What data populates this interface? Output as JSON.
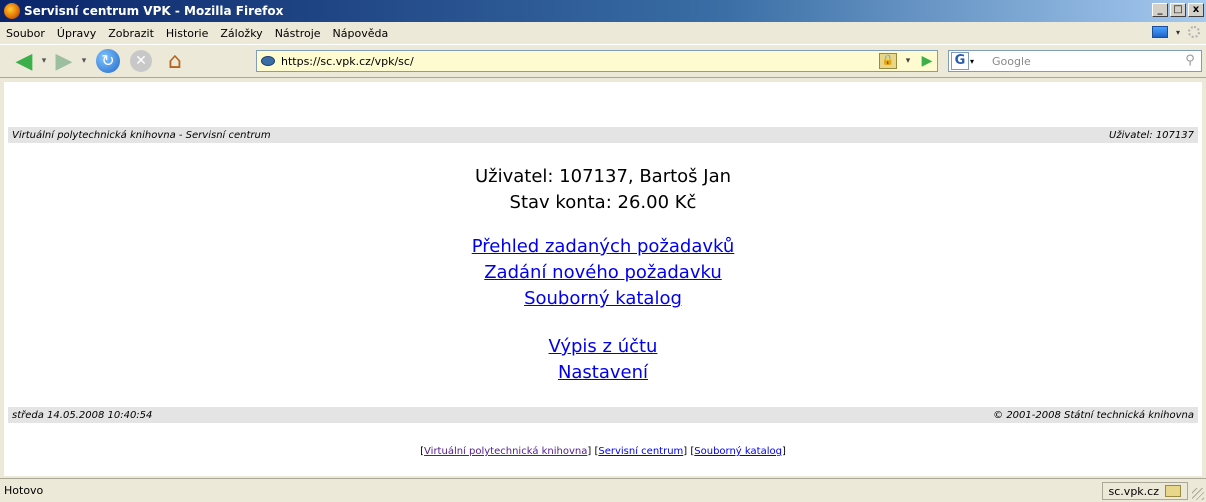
{
  "window": {
    "title": "Servisní centrum VPK - Mozilla Firefox",
    "controls": [
      "_",
      "□",
      "x"
    ]
  },
  "menu": {
    "items": [
      "Soubor",
      "Úpravy",
      "Zobrazit",
      "Historie",
      "Záložky",
      "Nástroje",
      "Nápověda"
    ]
  },
  "nav": {
    "url": "https://sc.vpk.cz/vpk/sc/",
    "search_placeholder": "Google",
    "search_engine_letter": "G"
  },
  "page": {
    "header_left": "Virtuální polytechnická knihovna - Servisní centrum",
    "header_right": "Uživatel: 107137",
    "user_line": "Uživatel: 107137, Bartoš Jan",
    "balance_line": "Stav konta: 26.00 Kč",
    "links": [
      "Přehled zadaných požadavků",
      "Zadání nového požadavku",
      "Souborný katalog",
      "Výpis z účtu",
      "Nastavení"
    ],
    "footer_left": "středa 14.05.2008 10:40:54",
    "footer_right": "© 2001-2008 Státní technická knihovna",
    "bottom_links": [
      "Virtuální polytechnická knihovna",
      "Servisní centrum",
      "Souborný katalog"
    ]
  },
  "status": {
    "text": "Hotovo",
    "host": "sc.vpk.cz"
  }
}
